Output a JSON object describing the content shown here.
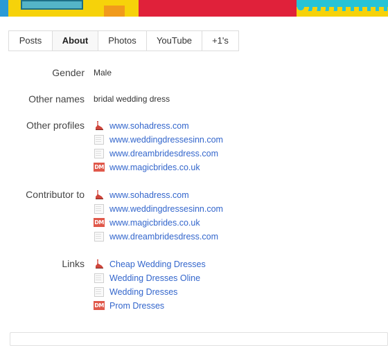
{
  "tabs": [
    {
      "label": "Posts",
      "active": false
    },
    {
      "label": "About",
      "active": true
    },
    {
      "label": "Photos",
      "active": false
    },
    {
      "label": "YouTube",
      "active": false
    },
    {
      "label": "+1's",
      "active": false
    }
  ],
  "fields": {
    "gender": {
      "label": "Gender",
      "value": "Male"
    },
    "other_names": {
      "label": "Other names",
      "value": "bridal wedding dress"
    }
  },
  "other_profiles": {
    "label": "Other profiles",
    "items": [
      {
        "text": "www.sohadress.com",
        "icon": "shoe-icon"
      },
      {
        "text": "www.weddingdressesinn.com",
        "icon": "page-icon"
      },
      {
        "text": "www.dreambridesdress.com",
        "icon": "page-icon"
      },
      {
        "text": "www.magicbrides.co.uk",
        "icon": "dm-icon"
      }
    ]
  },
  "contributor_to": {
    "label": "Contributor to",
    "items": [
      {
        "text": "www.sohadress.com",
        "icon": "shoe-icon"
      },
      {
        "text": "www.weddingdressesinn.com",
        "icon": "page-icon"
      },
      {
        "text": "www.magicbrides.co.uk",
        "icon": "dm-icon"
      },
      {
        "text": "www.dreambridesdress.com",
        "icon": "page-icon"
      }
    ]
  },
  "links": {
    "label": "Links",
    "items": [
      {
        "text": "Cheap Wedding Dresses",
        "icon": "shoe-icon"
      },
      {
        "text": "Wedding Dresses Oline",
        "icon": "page-icon"
      },
      {
        "text": "Wedding Dresses",
        "icon": "page-icon"
      },
      {
        "text": "Prom Dresses",
        "icon": "dm-icon"
      }
    ]
  },
  "icons": {
    "dm_text": "DM"
  },
  "colors": {
    "link": "#3366cc",
    "banner_yellow": "#f6d20a",
    "banner_red": "#e0213a",
    "banner_cyan": "#27c3d6"
  }
}
